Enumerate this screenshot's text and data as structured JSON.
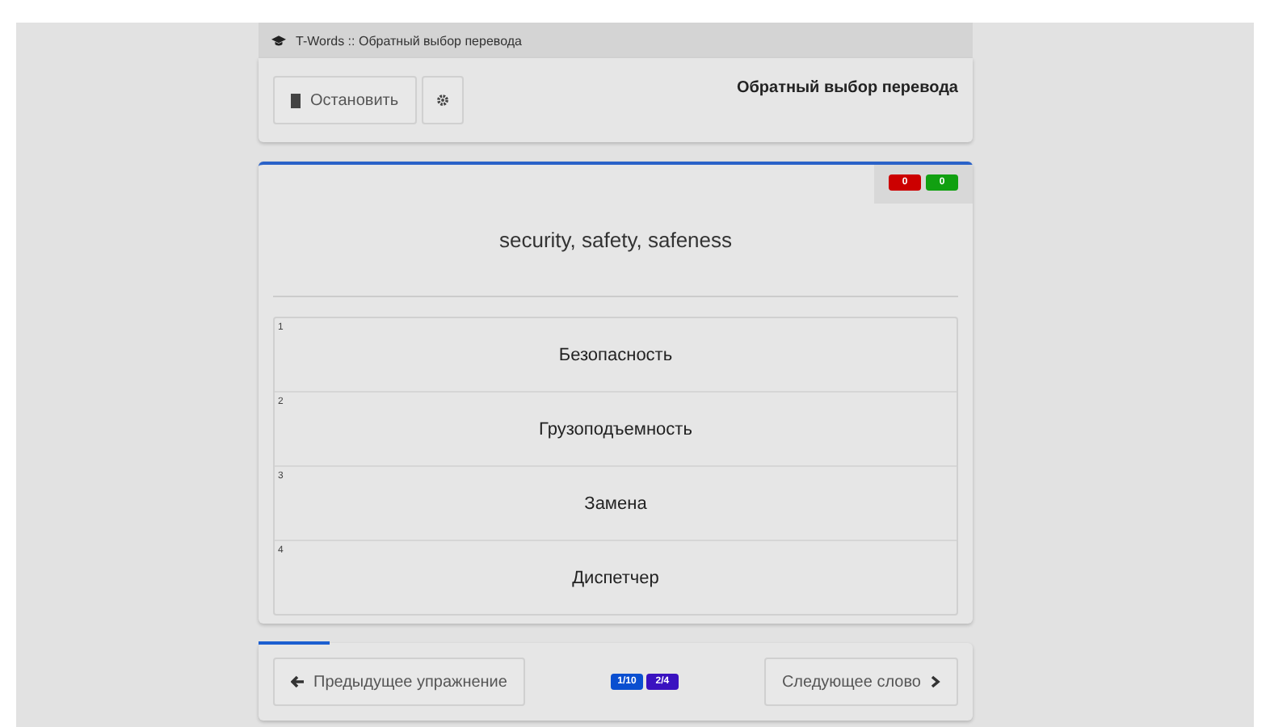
{
  "window": {
    "title": "T-Words :: Обратный выбор перевода"
  },
  "toolbar": {
    "stop_button": "Остановить",
    "heading": "Обратный выбор перевода"
  },
  "score": [
    {
      "label": "0",
      "color": "#cc0000"
    },
    {
      "label": "0",
      "color": "#11a011"
    }
  ],
  "word": "security, safety, safeness",
  "options": [
    {
      "number": "1",
      "text": "Безопасность"
    },
    {
      "number": "2",
      "text": "Грузоподъемность"
    },
    {
      "number": "3",
      "text": "Замена"
    },
    {
      "number": "4",
      "text": "Диспетчер"
    }
  ],
  "footer": {
    "progress": {
      "level": 0.1
    },
    "prev_button": "Предыдущее упражнение",
    "next_button": "Следующее слово",
    "badges": [
      {
        "label": "1/10",
        "color": "#0a4fd0"
      },
      {
        "label": "2/4",
        "color": "#3a12c0"
      }
    ]
  }
}
